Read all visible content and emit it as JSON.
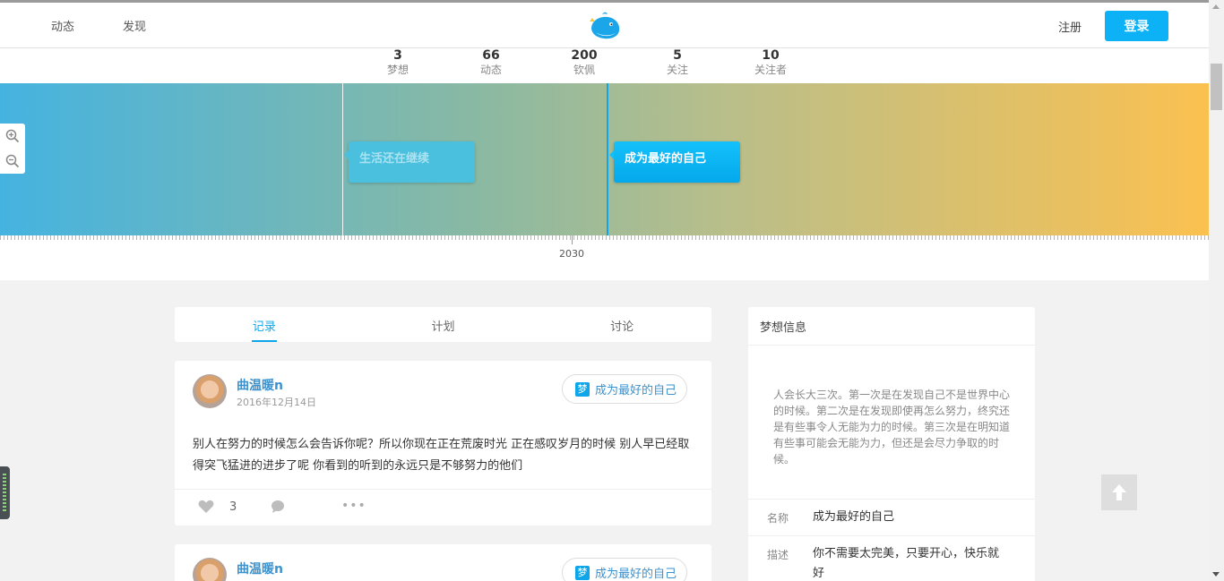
{
  "nav": {
    "left_items": [
      "动态",
      "发现"
    ],
    "register_label": "注册",
    "login_label": "登录"
  },
  "stats": [
    {
      "value": "3",
      "label": "梦想"
    },
    {
      "value": "66",
      "label": "动态"
    },
    {
      "value": "200",
      "label": "钦佩"
    },
    {
      "value": "5",
      "label": "关注"
    },
    {
      "value": "10",
      "label": "关注者"
    }
  ],
  "timeline": {
    "cards": [
      {
        "label": "生活还在继续",
        "state": "faded"
      },
      {
        "label": "成为最好的自己",
        "state": "active"
      }
    ],
    "year_label": "2030",
    "gradient_colors": [
      "#45b3e0",
      "#8bb9a2",
      "#b9be8a",
      "#fbc150"
    ]
  },
  "tabs": [
    "记录",
    "计划",
    "讨论"
  ],
  "active_tab": "记录",
  "posts": [
    {
      "author": "曲温暖n",
      "date": "2016年12月14日",
      "dream_badge": "梦",
      "dream": "成为最好的自己",
      "body": "别人在努力的时候怎么会告诉你呢？所以你现在正在荒废时光 正在感叹岁月的时候 别人早已经取得突飞猛进的进步了呢 你看到的听到的永远只是不够努力的他们",
      "likes": "3"
    },
    {
      "author": "曲温暖n",
      "dream_badge": "梦",
      "dream": "成为最好的自己"
    }
  ],
  "info": {
    "title": "梦想信息",
    "quote": "人会长大三次。第一次是在发现自己不是世界中心的时候。第二次是在发现即使再怎么努力，终究还是有些事令人无能为力的时候。第三次是在明知道有些事可能会无能为力，但还是会尽力争取的时候。",
    "name_key": "名称",
    "name_value": "成为最好的自己",
    "desc_key": "描述",
    "desc_value": "你不需要太完美，只要开心，快乐就好"
  },
  "colors": {
    "accent": "#0ea6e9",
    "login": "#0db1f5",
    "link": "#3a92cf"
  }
}
